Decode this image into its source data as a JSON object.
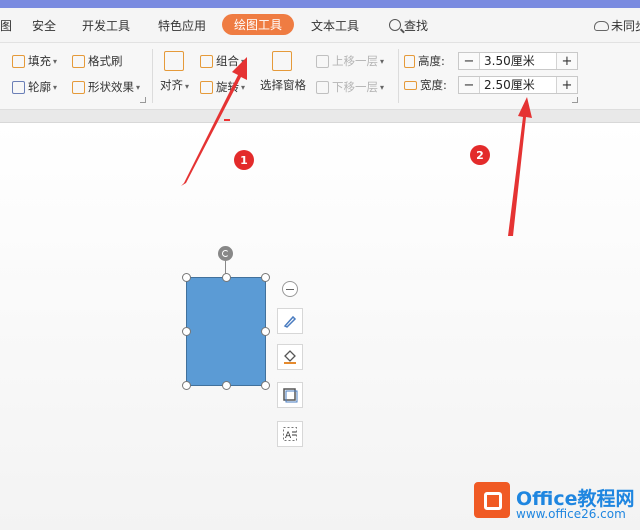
{
  "tabs": [
    {
      "label": "图",
      "active": false
    },
    {
      "label": "安全",
      "active": false
    },
    {
      "label": "开发工具",
      "active": false
    },
    {
      "label": "特色应用",
      "active": false
    },
    {
      "label": "绘图工具",
      "active": true
    },
    {
      "label": "文本工具",
      "active": false
    },
    {
      "label": "查找",
      "active": false
    },
    {
      "label": "未同步",
      "active": false
    }
  ],
  "ribbon": {
    "fill": "填充",
    "format_painter": "格式刷",
    "outline": "轮廓",
    "shape_effects": "形状效果",
    "align": "对齐",
    "group": "组合",
    "rotate": "旋转",
    "selection_pane": "选择窗格",
    "bring_forward": "上移一层",
    "send_backward": "下移一层",
    "height_label": "高度:",
    "height_value": "3.50厘米",
    "width_label": "宽度:",
    "width_value": "2.50厘米",
    "minus": "−",
    "plus": "+"
  },
  "annotations": {
    "badge1": "1",
    "badge2": "2"
  },
  "watermark": {
    "title": "Office教程网",
    "url": "www.office26.com"
  },
  "colors": {
    "accent_tab": "#ef7c42",
    "shape_fill": "#5b9bd5",
    "arrow": "#e53333",
    "badge": "#e32b2b"
  }
}
